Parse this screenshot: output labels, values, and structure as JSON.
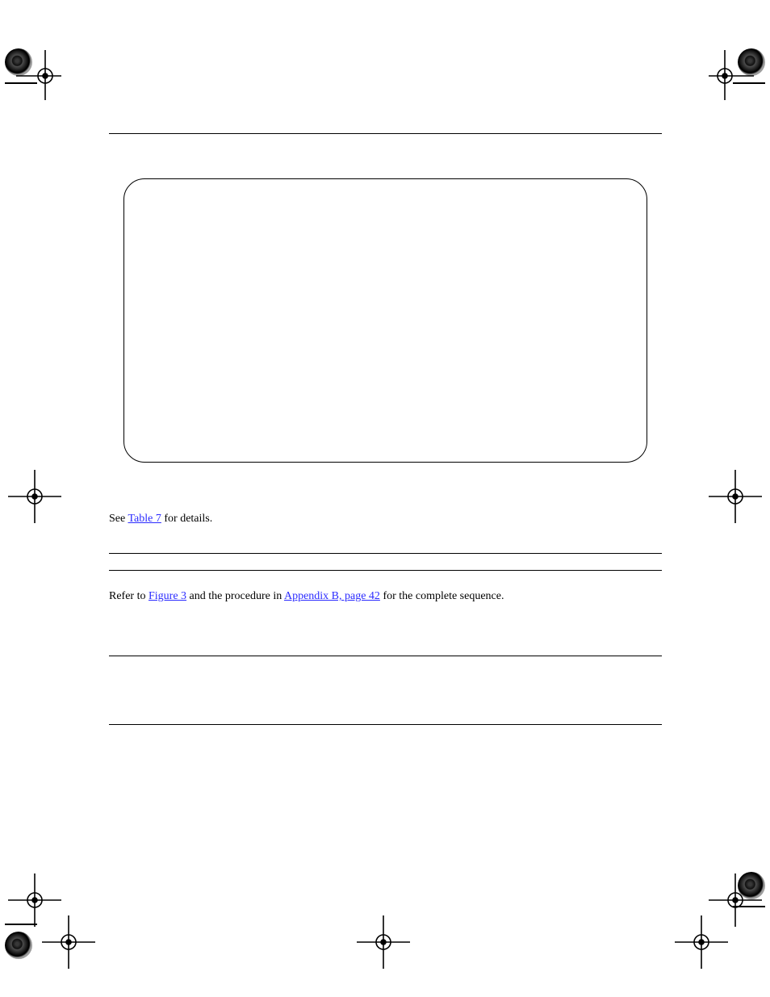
{
  "body": {
    "para1_prefix": "See ",
    "para1_link": "Table 7",
    "para1_suffix": " for details."
  },
  "section": {
    "para_prefix": "Refer to ",
    "para_link1": "Figure 3",
    "para_mid": " and the procedure in ",
    "para_link2": "Appendix B, page 42",
    "para_suffix": " for the complete sequence."
  }
}
